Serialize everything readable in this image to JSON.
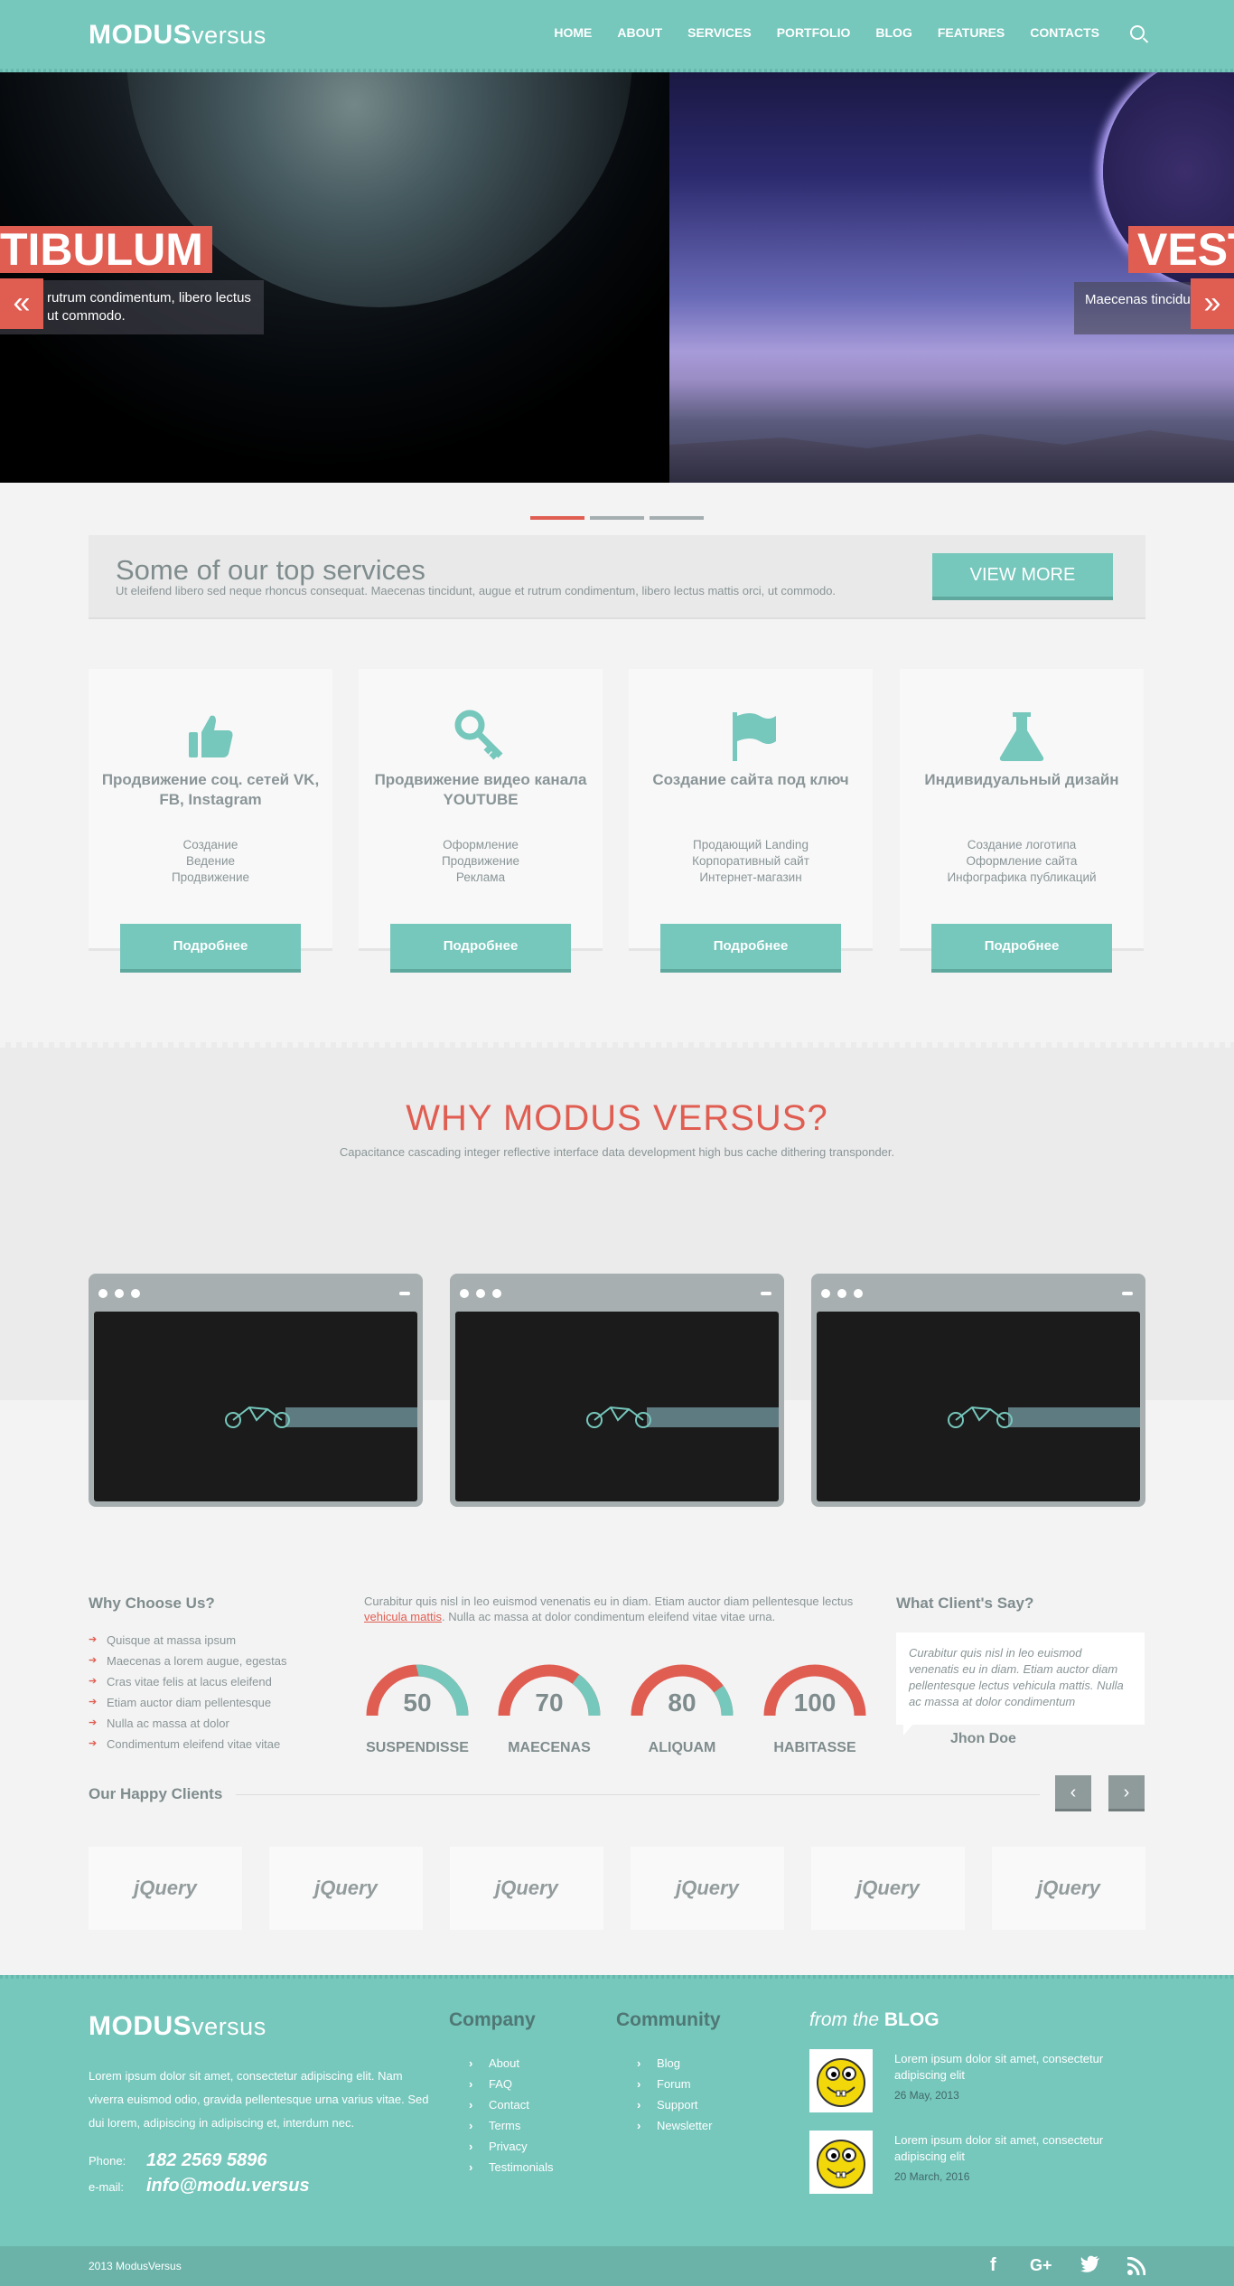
{
  "header": {
    "logo_bold": "MODUS",
    "logo_light": "versus",
    "nav": [
      "HOME",
      "ABOUT",
      "SERVICES",
      "PORTFOLIO",
      "BLOG",
      "FEATURES",
      "CONTACTS"
    ]
  },
  "hero": {
    "left_title": "TIBULUM",
    "left_caption_1": "rutrum condimentum, libero lectus",
    "left_caption_2": "ut commodo.",
    "right_title": "VEST",
    "right_caption": "Maecenas tincidu",
    "prev_icon": "«",
    "next_icon": "»"
  },
  "banner": {
    "title": "Some of our top services",
    "text": "Ut eleifend libero sed neque rhoncus consequat. Maecenas tincidunt, augue et rutrum condimentum, libero lectus mattis orci, ut commodo.",
    "button": "VIEW MORE"
  },
  "services": [
    {
      "icon": "thumbs-up-icon",
      "title": "Продвижение соц. сетей VK, FB, Instagram",
      "lines": [
        "Создание",
        "Ведение",
        "Продвижение"
      ],
      "button": "Подробнее"
    },
    {
      "icon": "key-icon",
      "title": "Продвижение видео канала YOUTUBE",
      "lines": [
        "Оформление",
        "Продвижение",
        "Реклама"
      ],
      "button": "Подробнее"
    },
    {
      "icon": "flag-icon",
      "title": "Создание сайта под ключ",
      "lines": [
        "Продающий Landing",
        "Корпоративный сайт",
        "Интернет-магазин"
      ],
      "button": "Подробнее"
    },
    {
      "icon": "flask-icon",
      "title": "Индивидуальный дизайн",
      "lines": [
        "Создание логотипа",
        "Оформление сайта",
        "Инфографика публикаций"
      ],
      "button": "Подробнее"
    }
  ],
  "why": {
    "title": "WHY MODUS VERSUS?",
    "subtitle": "Capacitance cascading integer reflective interface data development high bus cache dithering transponder."
  },
  "why_choose": {
    "title": "Why Choose Us?",
    "items": [
      "Quisque at massa ipsum",
      "Maecenas a lorem augue, egestas",
      "Cras vitae felis at lacus eleifend",
      "Etiam auctor diam pellentesque",
      "Nulla ac massa at dolor",
      "Condimentum eleifend vitae vitae"
    ]
  },
  "stats": {
    "intro_1": "Curabitur quis nisl in leo euismod venenatis eu in diam. Etiam auctor diam pellentesque",
    "intro_2a": "lectus ",
    "intro_link": "vehicula mattis",
    "intro_2b": ". Nulla ac massa at dolor condimentum eleifend vitae vitae urna.",
    "gauges": [
      {
        "value": 50,
        "label": "SUSPENDISSE"
      },
      {
        "value": 70,
        "label": "MAECENAS"
      },
      {
        "value": 80,
        "label": "ALIQUAM"
      },
      {
        "value": 100,
        "label": "HABITASSE"
      }
    ],
    "colors": {
      "red": "#e05d52",
      "teal": "#76c7bc"
    }
  },
  "testimonial": {
    "title": "What Client's Say?",
    "text": "Curabitur quis nisl in leo euismod venenatis eu in diam. Etiam auctor diam pellentesque lectus vehicula mattis. Nulla ac massa at dolor condimentum",
    "author": "Jhon Doe"
  },
  "clients": {
    "title": "Our Happy Clients",
    "prev": "‹",
    "next": "›",
    "logos": [
      "jQuery",
      "jQuery",
      "jQuery",
      "jQuery",
      "jQuery",
      "jQuery"
    ]
  },
  "footer": {
    "logo_bold": "MODUS",
    "logo_light": "versus",
    "about": "Lorem ipsum dolor sit amet, consectetur adipiscing elit. Nam viverra euismod odio, gravida pellentesque urna varius vitae. Sed dui lorem, adipiscing in adipiscing et, interdum nec.",
    "phone_label": "Phone:",
    "phone": "182 2569 5896",
    "email_label": "e-mail:",
    "email": "info@modu.versus",
    "company_title": "Company",
    "company_links": [
      "About",
      "FAQ",
      "Contact",
      "Terms",
      "Privacy",
      "Testimonials"
    ],
    "community_title": "Community",
    "community_links": [
      "Blog",
      "Forum",
      "Support",
      "Newsletter"
    ],
    "blog_title_a": "from the",
    "blog_title_b": "BLOG",
    "posts": [
      {
        "title": "Lorem ipsum dolor sit amet, consectetur adipiscing elit",
        "date": "26 May, 2013"
      },
      {
        "title": "Lorem ipsum dolor sit amet, consectetur adipiscing elit",
        "date": "20 March, 2016"
      }
    ],
    "copyright": "2013 ModusVersus",
    "social": [
      "facebook-icon",
      "google-plus-icon",
      "twitter-icon",
      "rss-icon"
    ]
  }
}
